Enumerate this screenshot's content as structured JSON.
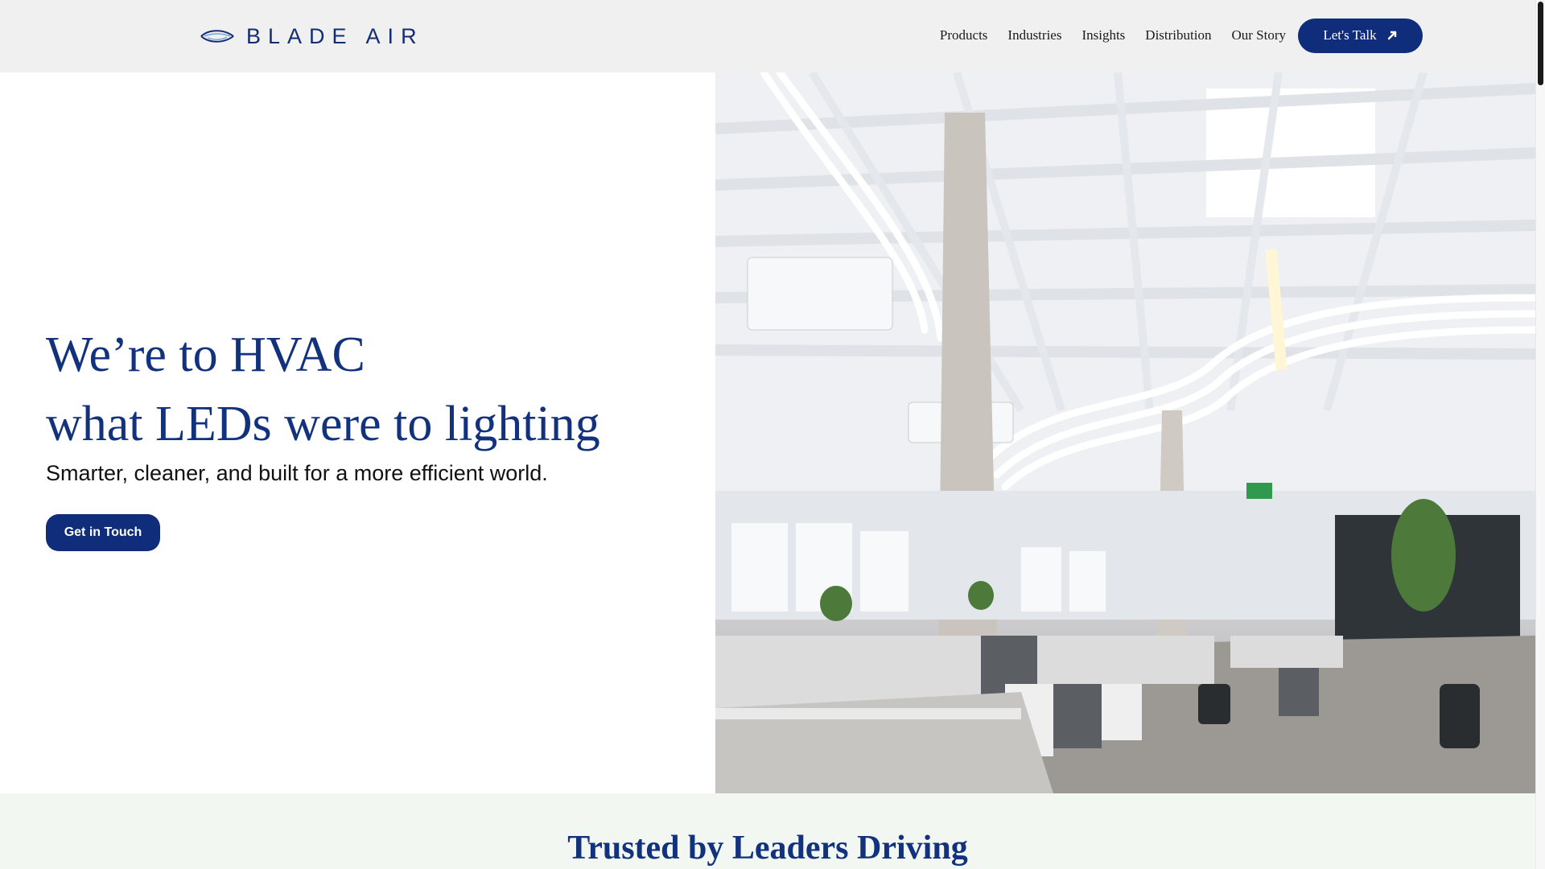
{
  "header": {
    "logo_text": "BLADE AIR",
    "nav": [
      "Products",
      "Industries",
      "Insights",
      "Distribution",
      "Our Story"
    ],
    "cta_label": "Let's Talk"
  },
  "hero": {
    "title_line1": "We’re to HVAC",
    "title_line2": "what LEDs were to lighting",
    "subtitle": "Smarter, cleaner, and built for a more efficient world.",
    "button_label": "Get in Touch"
  },
  "trusted": {
    "title": "Trusted by Leaders Driving"
  },
  "colors": {
    "brand_navy": "#0f2d7a",
    "heading_blue": "#12327e",
    "header_bg": "#f0f0f0",
    "trusted_bg": "#f2f7f2"
  },
  "icons": {
    "logo_mark": "blade-air-logo-icon",
    "cta_arrow": "arrow-up-right-icon"
  }
}
